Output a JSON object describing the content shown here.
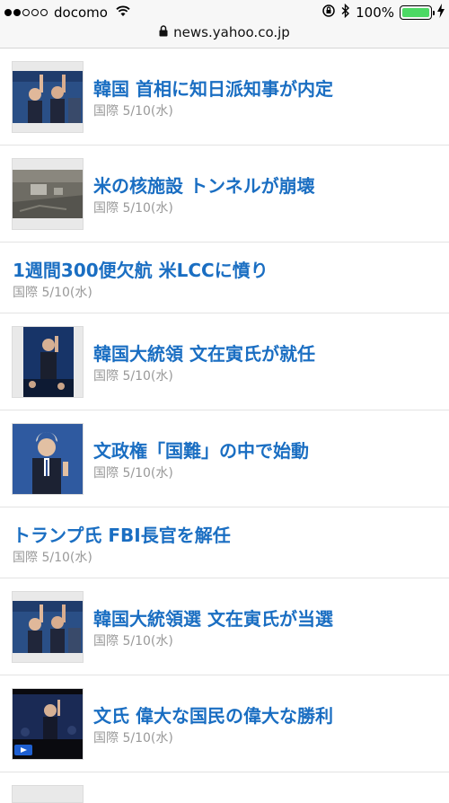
{
  "status": {
    "carrier": "docomo",
    "signal_filled": 2,
    "signal_total": 5,
    "wifi_icon": "wifi-icon",
    "battery_percent": "100%",
    "battery_level": 1.0,
    "battery_color": "#4cd964"
  },
  "browser": {
    "url": "news.yahoo.co.jp"
  },
  "news": [
    {
      "title": "韓国 首相に知日派知事が内定",
      "category": "国際",
      "date": "5/10(水)",
      "has_image": true
    },
    {
      "title": "米の核施設 トンネルが崩壊",
      "category": "国際",
      "date": "5/10(水)",
      "has_image": true
    },
    {
      "title": "1週間300便欠航 米LCCに憤り",
      "category": "国際",
      "date": "5/10(水)",
      "has_image": false
    },
    {
      "title": "韓国大統領 文在寅氏が就任",
      "category": "国際",
      "date": "5/10(水)",
      "has_image": true
    },
    {
      "title": "文政権「国難」の中で始動",
      "category": "国際",
      "date": "5/10(水)",
      "has_image": true
    },
    {
      "title": "トランプ氏 FBI長官を解任",
      "category": "国際",
      "date": "5/10(水)",
      "has_image": false
    },
    {
      "title": "韓国大統領選 文在寅氏が当選",
      "category": "国際",
      "date": "5/10(水)",
      "has_image": true
    },
    {
      "title": "文氏 偉大な国民の偉大な勝利",
      "category": "国際",
      "date": "5/10(水)",
      "has_image": true
    }
  ],
  "colors": {
    "link": "#1a6ec2",
    "meta": "#999999"
  }
}
